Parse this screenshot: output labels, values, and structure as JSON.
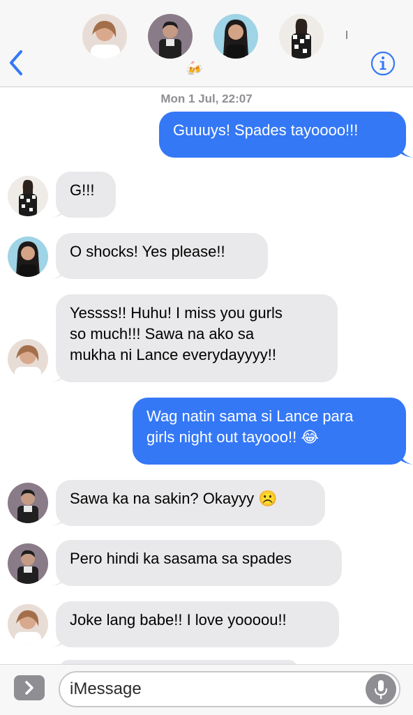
{
  "header": {
    "back_icon": "chevron-left-icon",
    "info_icon": "info-icon",
    "group_emoji": "🍻",
    "accent": "#3478f6"
  },
  "timestamp": "Mon 1 Jul, 22:07",
  "messages": [
    {
      "from": "me",
      "text": "Guuuys! Spades tayoooo!!!"
    },
    {
      "from": "friend-checker",
      "text": "G!!!"
    },
    {
      "from": "friend-dark",
      "text": "O shocks! Yes please!!"
    },
    {
      "from": "friend-blonde",
      "text": "Yessss!! Huhu! I miss you gurls\nso much!!! Sawa na ako sa\nmukha ni Lance everydayyyy!!"
    },
    {
      "from": "me",
      "text": "Wag natin sama si Lance para\ngirls night out tayooo!! 😂"
    },
    {
      "from": "lance",
      "text": "Sawa ka na sakin? Okayyy ☹️"
    },
    {
      "from": "lance",
      "text": "Pero hindi ka sasama sa spades"
    },
    {
      "from": "friend-blonde",
      "text": "Joke lang babe!! I love yoooou!!"
    }
  ],
  "composer": {
    "placeholder": "iMessage",
    "apps_icon": "chevron-right-icon",
    "mic_icon": "microphone-icon"
  },
  "colors": {
    "outgoing": "#3478f6",
    "incoming": "#e9e9eb",
    "header_bg": "#f7f7f7"
  }
}
